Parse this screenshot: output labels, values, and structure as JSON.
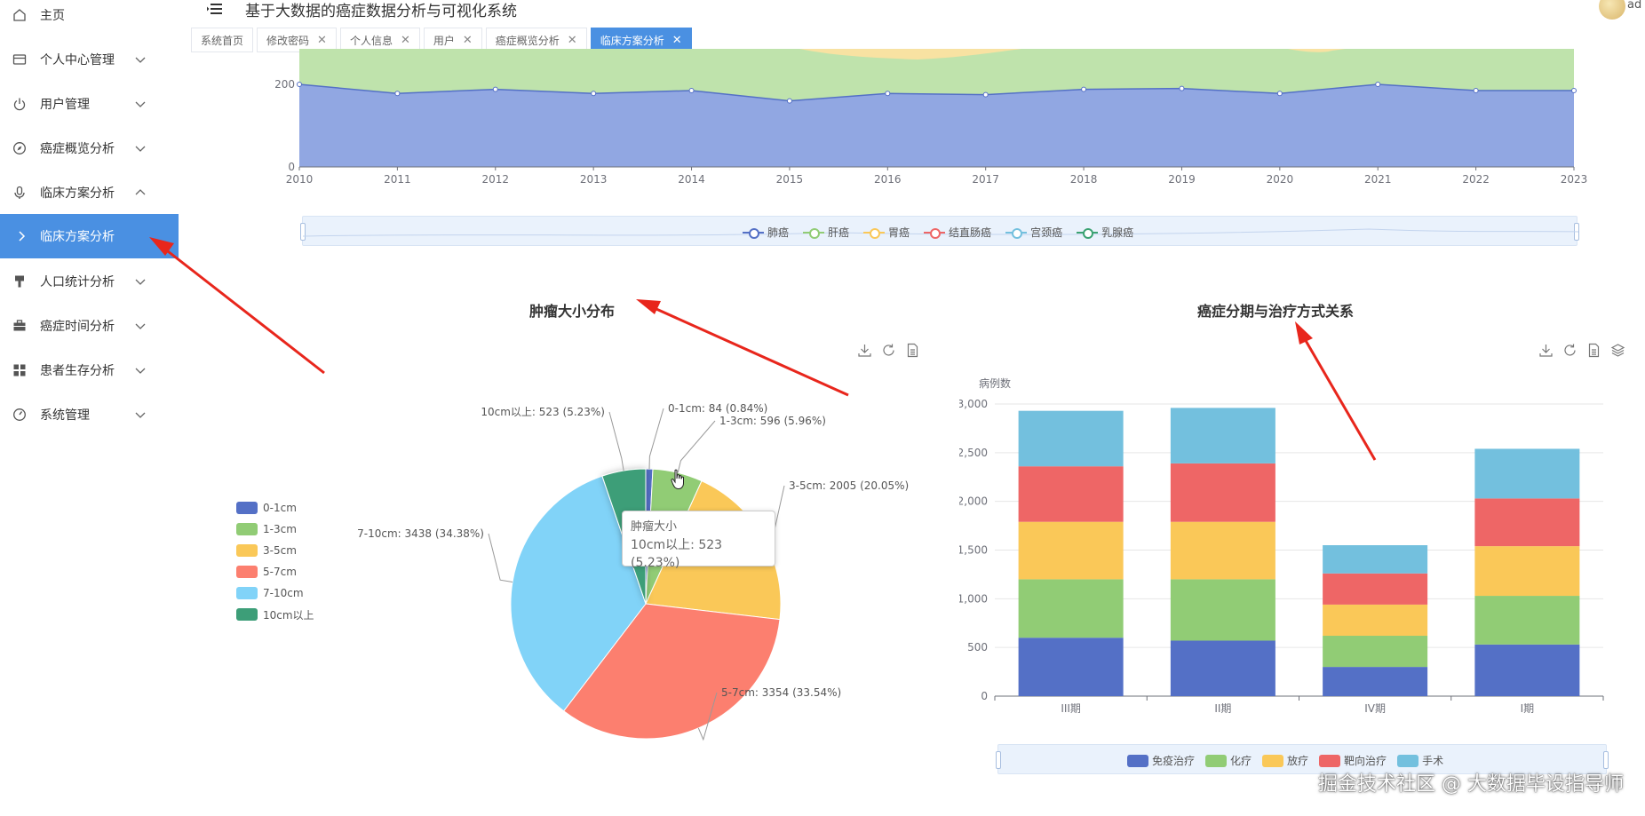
{
  "header": {
    "title": "基于大数据的癌症数据分析与可视化系统",
    "user": "ad"
  },
  "sidebar": {
    "items": [
      {
        "label": "主页",
        "icon": "home-icon"
      },
      {
        "label": "个人中心管理",
        "icon": "card-icon"
      },
      {
        "label": "用户管理",
        "icon": "power-icon"
      },
      {
        "label": "癌症概览分析",
        "icon": "compass-icon"
      },
      {
        "label": "临床方案分析",
        "icon": "microphone-icon"
      },
      {
        "label": "临床方案分析",
        "icon": "chevron-right-icon"
      },
      {
        "label": "人口统计分析",
        "icon": "brush-icon"
      },
      {
        "label": "癌症时间分析",
        "icon": "briefcase-icon"
      },
      {
        "label": "患者生存分析",
        "icon": "grid-icon"
      },
      {
        "label": "系统管理",
        "icon": "gauge-icon"
      }
    ]
  },
  "tabs": [
    {
      "label": "系统首页",
      "closable": false
    },
    {
      "label": "修改密码",
      "closable": true
    },
    {
      "label": "个人信息",
      "closable": true
    },
    {
      "label": "用户",
      "closable": true
    },
    {
      "label": "癌症概览分析",
      "closable": true
    },
    {
      "label": "临床方案分析",
      "closable": true,
      "active": true
    }
  ],
  "colors": {
    "accent": "#4a90e2",
    "blue": "#5470c6",
    "green": "#91cc75",
    "yellow": "#fac858",
    "red": "#ee6666",
    "cyan": "#73c0de",
    "teal": "#3ba272",
    "salmon": "#fc8452",
    "sky": "#81d3f8"
  },
  "chart_data": [
    {
      "type": "area",
      "x": [
        2010,
        2011,
        2012,
        2013,
        2014,
        2015,
        2016,
        2017,
        2018,
        2019,
        2020,
        2021,
        2022,
        2023
      ],
      "y_ticks": [
        0,
        200
      ],
      "series": [
        {
          "name": "肺癌",
          "values": [
            200,
            178,
            188,
            178,
            185,
            160,
            178,
            175,
            188,
            190,
            178,
            200,
            185,
            185
          ]
        }
      ],
      "legend": [
        "肺癌",
        "肝癌",
        "胃癌",
        "结直肠癌",
        "宫颈癌",
        "乳腺癌"
      ],
      "ylim": [
        0,
        200
      ]
    },
    {
      "type": "pie",
      "title": "肿瘤大小分布",
      "labels": [
        "0-1cm",
        "1-3cm",
        "3-5cm",
        "5-7cm",
        "7-10cm",
        "10cm以上"
      ],
      "values": [
        84,
        596,
        2005,
        3354,
        3438,
        523
      ],
      "slice_labels": [
        "0-1cm: 84 (0.84%)",
        "1-3cm: 596 (5.96%)",
        "3-5cm: 2005 (20.05%)",
        "5-7cm: 3354 (33.54%)",
        "7-10cm: 3438 (34.38%)",
        "10cm以上: 523 (5.23%)"
      ],
      "tooltip": {
        "title": "肿瘤大小",
        "value": "10cm以上: 523 (5.23%)"
      }
    },
    {
      "type": "bar",
      "stacked": true,
      "title": "癌症分期与治疗方式关系",
      "ylabel": "病例数",
      "categories": [
        "III期",
        "II期",
        "IV期",
        "I期"
      ],
      "ylim": [
        0,
        3000
      ],
      "y_ticks": [
        "0",
        "500",
        "1,000",
        "1,500",
        "2,000",
        "2,500",
        "3,000"
      ],
      "series": [
        {
          "name": "免疫治疗",
          "values": [
            600,
            570,
            300,
            530
          ]
        },
        {
          "name": "化疗",
          "values": [
            600,
            630,
            320,
            500
          ]
        },
        {
          "name": "放疗",
          "values": [
            590,
            590,
            320,
            510
          ]
        },
        {
          "name": "靶向治疗",
          "values": [
            570,
            600,
            320,
            490
          ]
        },
        {
          "name": "手术",
          "values": [
            570,
            570,
            290,
            510
          ]
        }
      ]
    }
  ],
  "watermark": "掘金技术社区 @ 大数据毕设指导师"
}
